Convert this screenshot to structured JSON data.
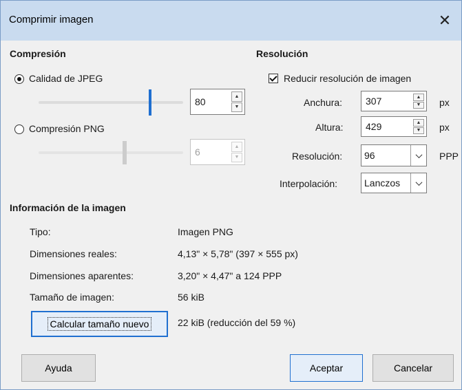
{
  "window": {
    "title": "Comprimir imagen",
    "close_glyph": "✕"
  },
  "compression": {
    "heading": "Compresión",
    "jpeg": {
      "label": "Calidad de JPEG",
      "selected": true,
      "value": "80",
      "slider_fraction": 0.78
    },
    "png": {
      "label": "Compresión PNG",
      "selected": false,
      "value": "6",
      "slider_fraction": 0.55
    }
  },
  "resolution": {
    "heading": "Resolución",
    "reduce": {
      "label": "Reducir resolución de imagen",
      "checked": true
    },
    "width": {
      "label": "Anchura:",
      "value": "307",
      "unit": "px"
    },
    "height": {
      "label": "Altura:",
      "value": "429",
      "unit": "px"
    },
    "dpi": {
      "label": "Resolución:",
      "value": "96",
      "unit": "PPP"
    },
    "interpolation": {
      "label": "Interpolación:",
      "value": "Lanczos"
    }
  },
  "info": {
    "heading": "Información de la imagen",
    "rows": [
      {
        "label": "Tipo:",
        "value": "Imagen PNG"
      },
      {
        "label": "Dimensiones reales:",
        "value": "4,13\" × 5,78\" (397 × 555 px)"
      },
      {
        "label": "Dimensiones aparentes:",
        "value": "3,20\" × 4,47\" a 124 PPP"
      },
      {
        "label": "Tamaño de imagen:",
        "value": "56 kiB"
      }
    ],
    "calculate_button": "Calcular tamaño nuevo",
    "new_size": "22 kiB (reducción del 59 %)"
  },
  "buttons": {
    "help": "Ayuda",
    "ok": "Aceptar",
    "cancel": "Cancelar"
  },
  "colors": {
    "titlebar": "#c9dbef",
    "accent": "#1f6fd0",
    "background": "#f0f0f0"
  }
}
